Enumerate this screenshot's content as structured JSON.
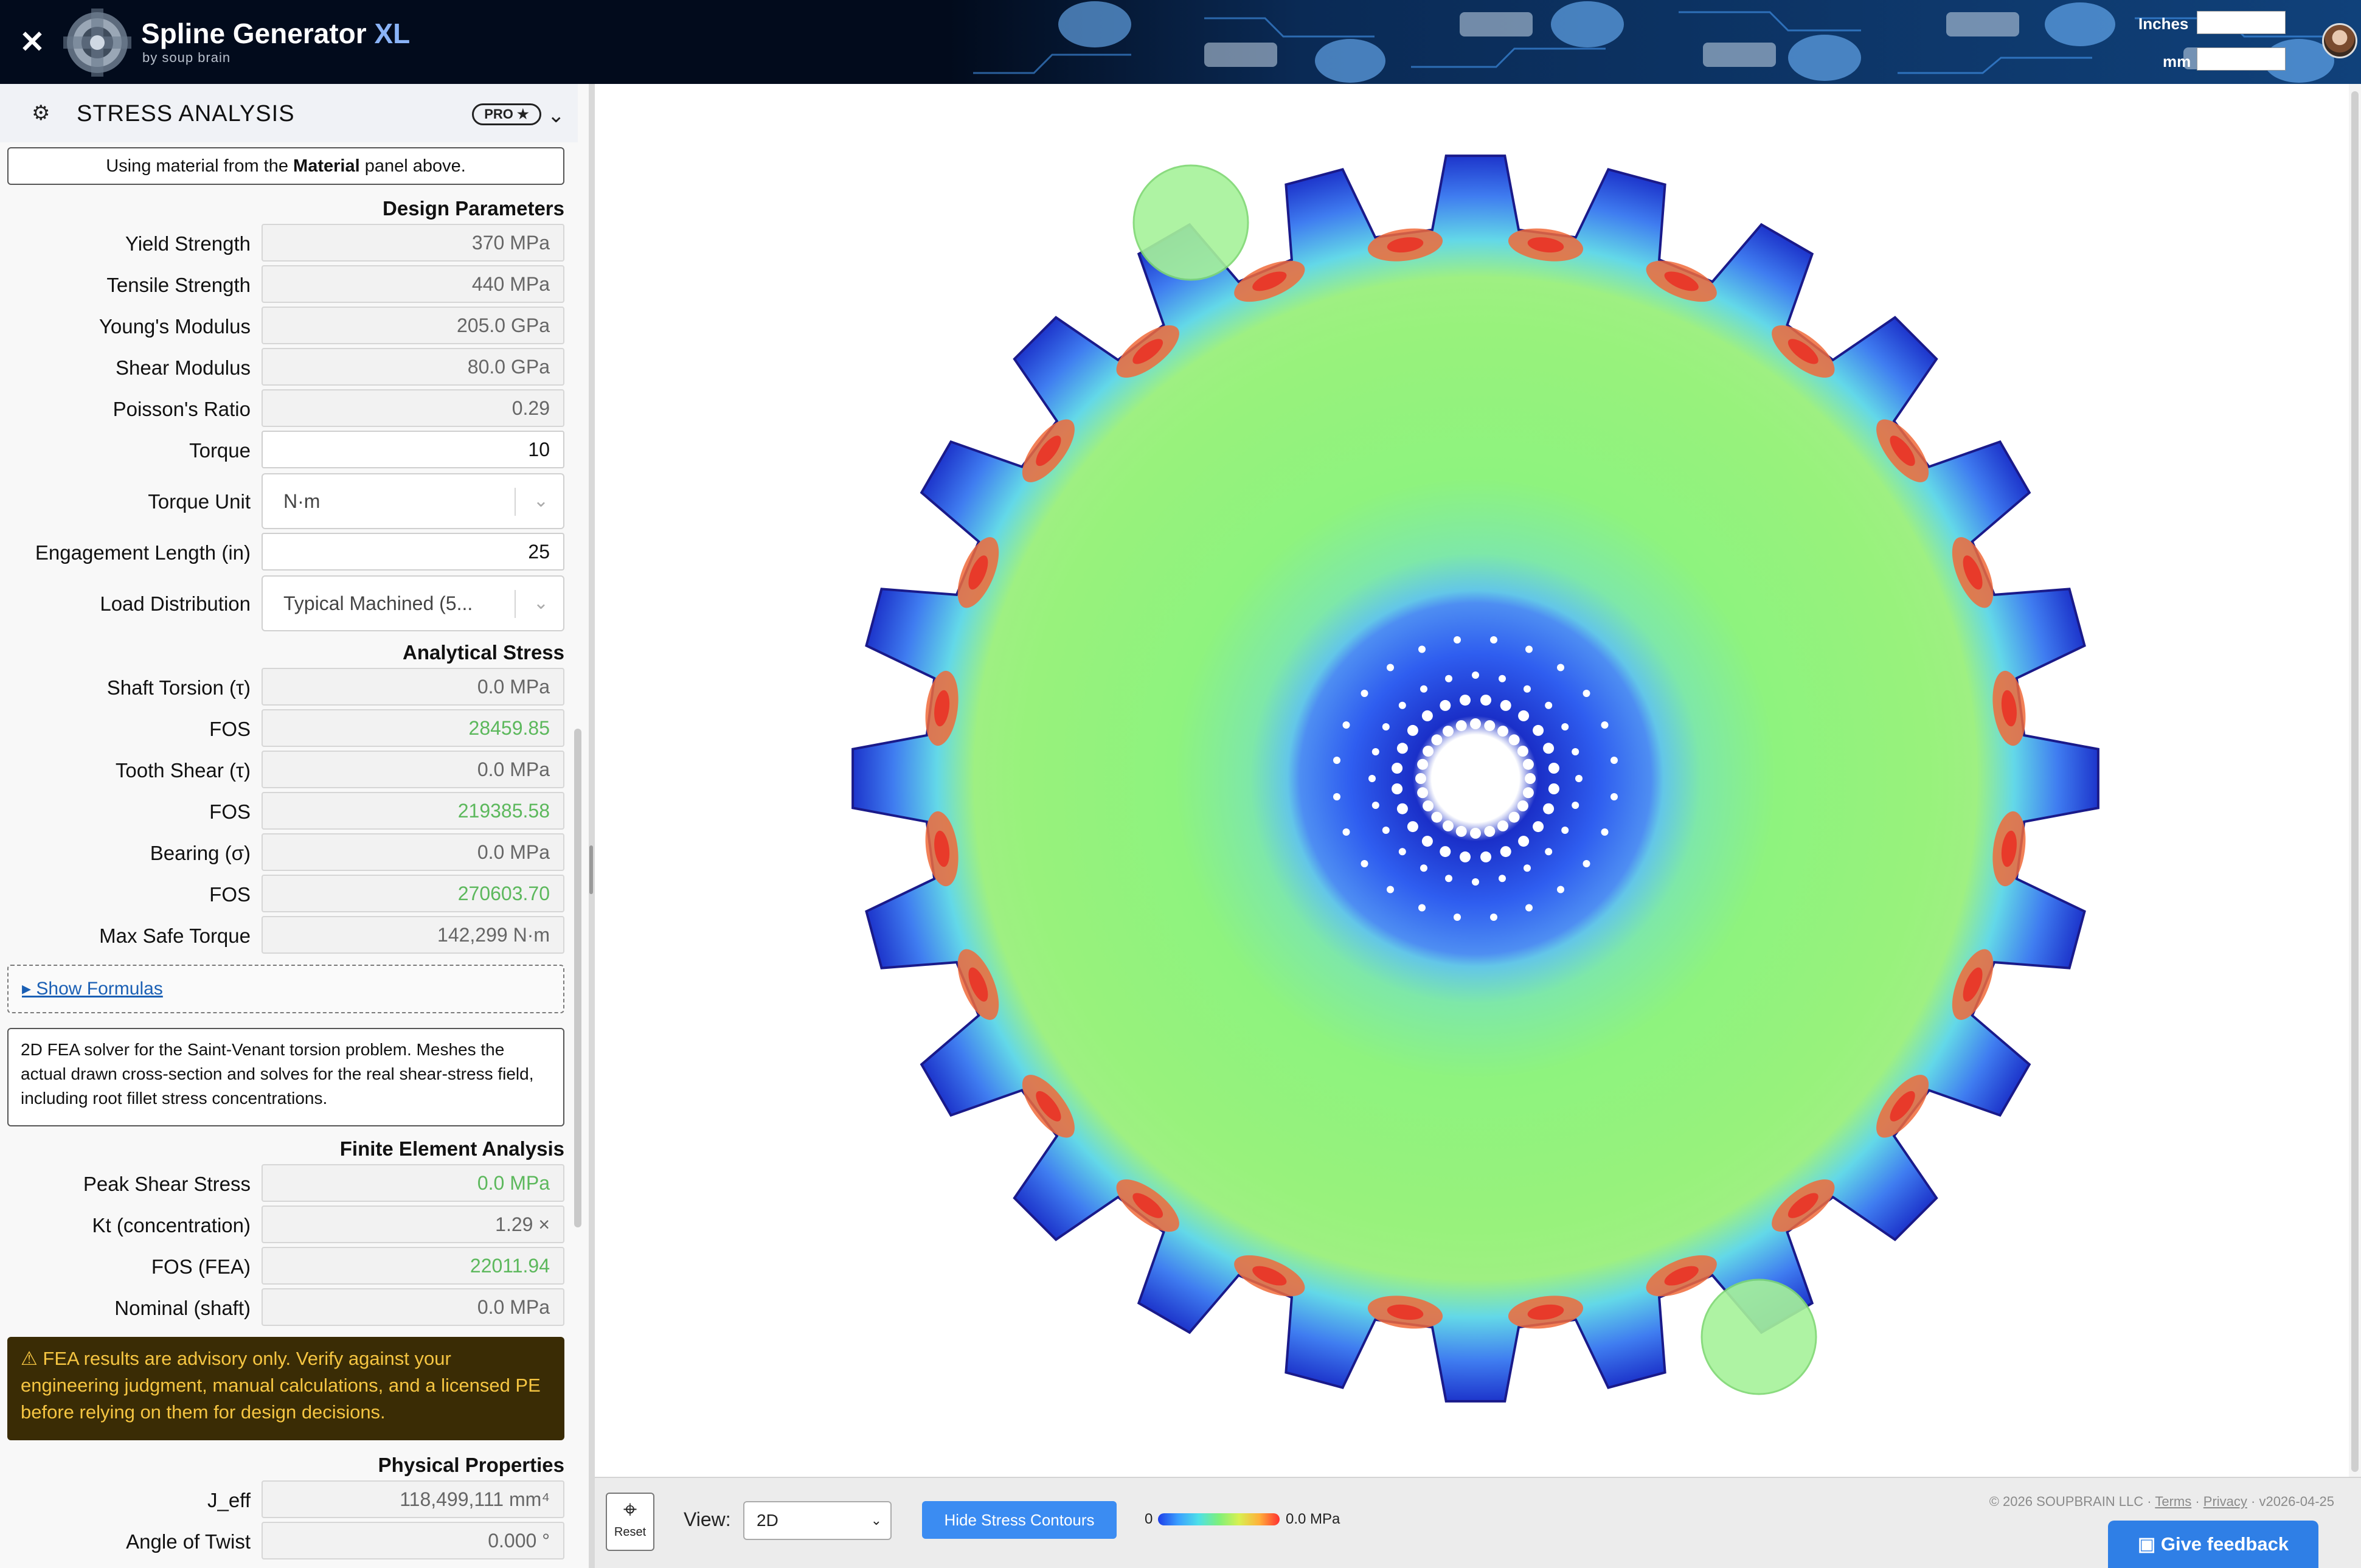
{
  "header": {
    "title": "Spline Generator",
    "title_suffix": "XL",
    "subtitle": "by soup brain",
    "close_icon": "✕",
    "units": {
      "inches_label": "Inches",
      "mm_label": "mm"
    }
  },
  "panel": {
    "title": "STRESS ANALYSIS",
    "badge": "PRO ★",
    "collapse_glyph": "⌄",
    "icon_glyph": "⚙",
    "material_note_pre": "Using material from the ",
    "material_note_bold": "Material",
    "material_note_post": " panel above.",
    "design": {
      "section_title": "Design Parameters",
      "yield_label": "Yield Strength",
      "yield_value": "370 MPa",
      "tensile_label": "Tensile Strength",
      "tensile_value": "440 MPa",
      "young_label": "Young's Modulus",
      "young_value": "205.0 GPa",
      "shear_label": "Shear Modulus",
      "shear_value": "80.0 GPa",
      "poisson_label": "Poisson's Ratio",
      "poisson_value": "0.29",
      "torque_label": "Torque",
      "torque_value": "10",
      "torque_unit_label": "Torque Unit",
      "torque_unit_value": "N·m",
      "engagement_label": "Engagement Length (in)",
      "engagement_value": "25",
      "load_label": "Load Distribution",
      "load_value": "Typical Machined (5..."
    },
    "analytical": {
      "section_title": "Analytical Stress",
      "torsion_label": "Shaft Torsion (τ)",
      "torsion_value": "0.0 MPa",
      "fos1_label": "FOS",
      "fos1_value": "28459.85",
      "tooth_label": "Tooth Shear (τ)",
      "tooth_value": "0.0 MPa",
      "fos2_label": "FOS",
      "fos2_value": "219385.58",
      "bearing_label": "Bearing (σ)",
      "bearing_value": "0.0 MPa",
      "fos3_label": "FOS",
      "fos3_value": "270603.70",
      "max_label": "Max Safe Torque",
      "max_value": "142,299 N·m"
    },
    "show_formulas": "▸ Show Formulas",
    "fea_description": "2D FEA solver for the Saint-Venant torsion problem. Meshes the actual drawn cross-section and solves for the real shear-stress field, including root fillet stress concentrations.",
    "fea": {
      "section_title": "Finite Element Analysis",
      "peak_label": "Peak Shear Stress",
      "peak_value": "0.0 MPa",
      "kt_label": "Kt (concentration)",
      "kt_value": "1.29 ×",
      "fos_label": "FOS (FEA)",
      "fos_value": "22011.94",
      "nominal_label": "Nominal (shaft)",
      "nominal_value": "0.0 MPa"
    },
    "warning": "⚠ FEA results are advisory only. Verify against your engineering judgment, manual calculations, and a licensed PE before relying on them for design decisions.",
    "physical": {
      "section_title": "Physical Properties",
      "jeff_label": "J_eff",
      "jeff_value": "118,499,111 mm⁴",
      "twist_label": "Angle of Twist",
      "twist_value": "0.000 °"
    }
  },
  "viewer": {
    "tooth_count": 24,
    "reset_label": "Reset",
    "reset_icon": "⌖",
    "view_label": "View:",
    "view_value": "2D",
    "stress_button": "Hide Stress Contours",
    "legend_min": "0",
    "legend_max": "0.0 MPa",
    "footer_copyright": "© 2026 SOUPBRAIN LLC · ",
    "footer_terms": "Terms",
    "footer_sep": " · ",
    "footer_privacy": "Privacy",
    "footer_version": " · v2026-04-25",
    "feedback": "Give feedback",
    "colors": {
      "deep": "#1a2fc8",
      "blue": "#3f7cf0",
      "cyan": "#4ed6ec",
      "green": "#8ef37e",
      "hot": "#f04a30"
    }
  }
}
